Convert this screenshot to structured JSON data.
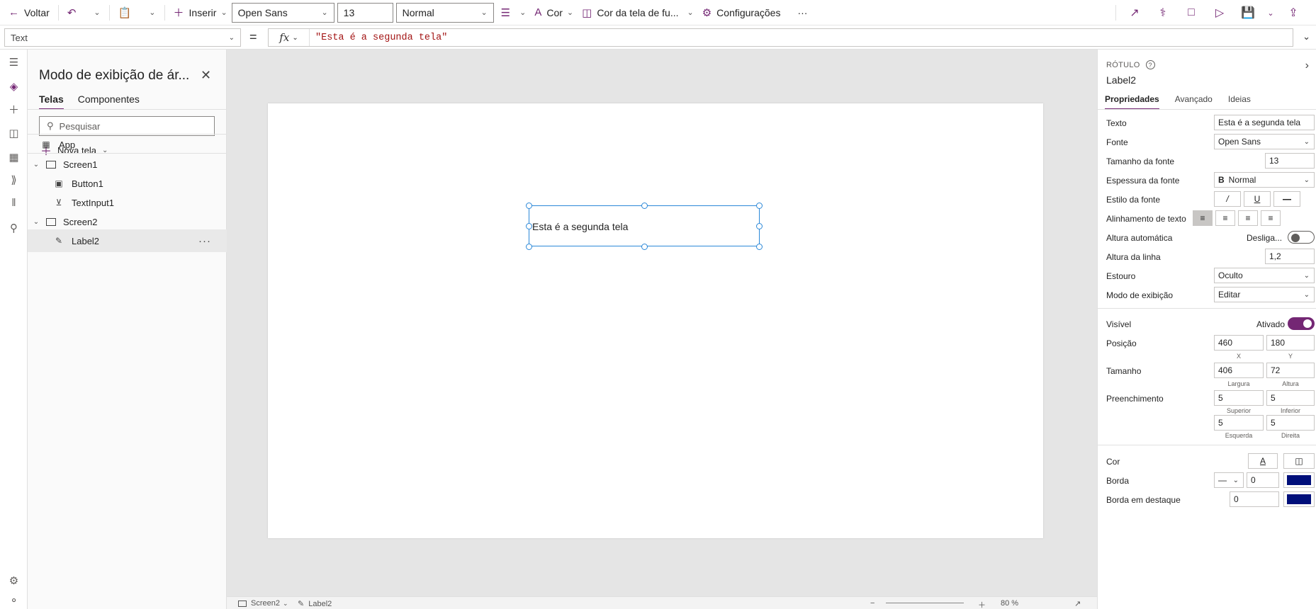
{
  "toolbar": {
    "back_label": "Voltar",
    "insert_label": "Inserir",
    "font_value": "Open Sans",
    "size_value": "13",
    "weight_value": "Normal",
    "color_label": "Cor",
    "fill_label": "Cor da tela de fu...",
    "settings_label": "Configurações",
    "more_label": "···"
  },
  "formula": {
    "property": "Text",
    "equals": "=",
    "fx": "fx",
    "value": "\"Esta é a segunda tela\""
  },
  "tree": {
    "title": "Modo de exibição de ár...",
    "tabs": [
      "Telas",
      "Componentes"
    ],
    "search_placeholder": "Pesquisar",
    "new_screen_label": "Nova tela",
    "nodes": {
      "app": "App",
      "screen1": "Screen1",
      "button1": "Button1",
      "textinput1": "TextInput1",
      "screen2": "Screen2",
      "label2": "Label2"
    }
  },
  "canvas": {
    "label_text": "Esta é a segunda tela",
    "status_screen": "Screen2",
    "status_control": "Label2",
    "zoom": "80 %"
  },
  "properties": {
    "type": "RÓTULO",
    "name": "Label2",
    "tabs": [
      "Propriedades",
      "Avançado",
      "Ideias"
    ],
    "rows": {
      "texto_label": "Texto",
      "texto_value": "Esta é a segunda tela",
      "fonte_label": "Fonte",
      "fonte_value": "Open Sans",
      "tamfonte_label": "Tamanho da fonte",
      "tamfonte_value": "13",
      "espessura_label": "Espessura da fonte",
      "espessura_value": "Normal",
      "estilo_label": "Estilo da fonte",
      "alinh_label": "Alinhamento de texto",
      "altauto_label": "Altura automática",
      "altauto_value": "Desliga...",
      "altlinha_label": "Altura da linha",
      "altlinha_value": "1,2",
      "estouro_label": "Estouro",
      "estouro_value": "Oculto",
      "modo_label": "Modo de exibição",
      "modo_value": "Editar",
      "visivel_label": "Visível",
      "visivel_value": "Ativado",
      "posicao_label": "Posição",
      "pos_x": "460",
      "pos_y": "180",
      "pos_x_sub": "X",
      "pos_y_sub": "Y",
      "tamanho_label": "Tamanho",
      "width_value": "406",
      "height_value": "72",
      "width_sub": "Largura",
      "height_sub": "Altura",
      "preench_label": "Preenchimento",
      "pad_top": "5",
      "pad_bottom": "5",
      "pad_top_sub": "Superior",
      "pad_bottom_sub": "Inferior",
      "pad_left": "5",
      "pad_right": "5",
      "pad_left_sub": "Esquerda",
      "pad_right_sub": "Direita",
      "cor_label": "Cor",
      "borda_label": "Borda",
      "borda_value": "0",
      "bordadest_label": "Borda em destaque",
      "bordadest_value": "0"
    }
  },
  "colors": {
    "accent": "#742774",
    "selection": "#2b88d8",
    "border_swatch": "#000f7a",
    "formula_text": "#a31515"
  }
}
